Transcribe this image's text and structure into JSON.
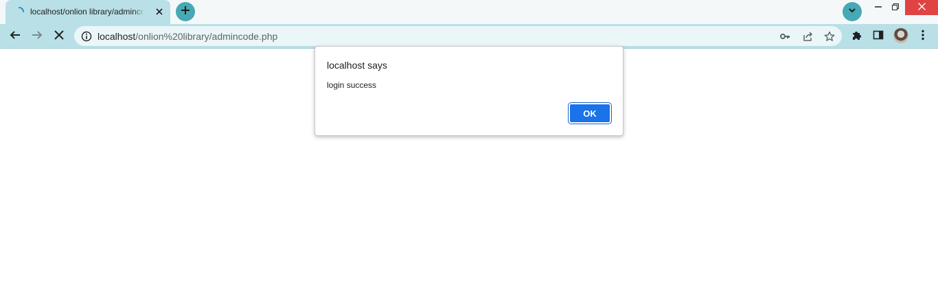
{
  "browser": {
    "tab": {
      "title": "localhost/onlion library/admincode.php",
      "loading": true
    },
    "address_bar": {
      "host": "localhost",
      "path": "/onlion%20library/admincode.php"
    },
    "icons": {
      "tab_spinner": "loading-spinner-icon",
      "tab_close": "close-icon",
      "new_tab": "plus-icon",
      "tab_search": "chevron-down-icon",
      "back": "arrow-left-icon",
      "forward": "arrow-right-icon",
      "stop": "close-icon",
      "site_info": "info-icon",
      "password": "key-icon",
      "share": "share-icon",
      "bookmark": "star-icon",
      "extensions": "puzzle-icon",
      "side_panel": "side-panel-icon",
      "menu": "kebab-menu-icon"
    },
    "colors": {
      "frame": "#b9e0e6",
      "accent_button": "#47a9b5",
      "close_button": "#e04343"
    }
  },
  "dialog": {
    "title": "localhost says",
    "message": "login success",
    "ok_label": "OK",
    "ok_color": "#1a73e8"
  }
}
